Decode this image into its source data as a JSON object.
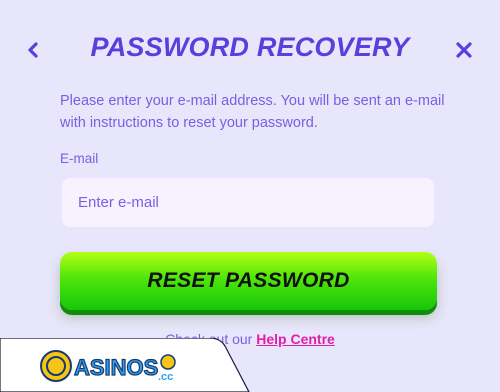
{
  "dialog": {
    "title": "PASSWORD RECOVERY",
    "back_icon": "chevron-left-icon",
    "close_icon": "close-icon",
    "description": "Please enter your e-mail address. You will be sent an e-mail with instructions to reset your password."
  },
  "form": {
    "email_label": "E-mail",
    "email_placeholder": "Enter e-mail",
    "email_value": "",
    "submit_label": "RESET PASSWORD"
  },
  "help": {
    "prefix": "Check out our",
    "link_label": "Help Centre"
  },
  "watermark": {
    "logo_text": "CASINOS",
    "logo_suffix": ".cc"
  },
  "colors": {
    "background": "#e8e6fa",
    "accent": "#5b3fdc",
    "text": "#7a5ee3",
    "link": "#e21fa8",
    "button_green": "#4ee60a"
  }
}
